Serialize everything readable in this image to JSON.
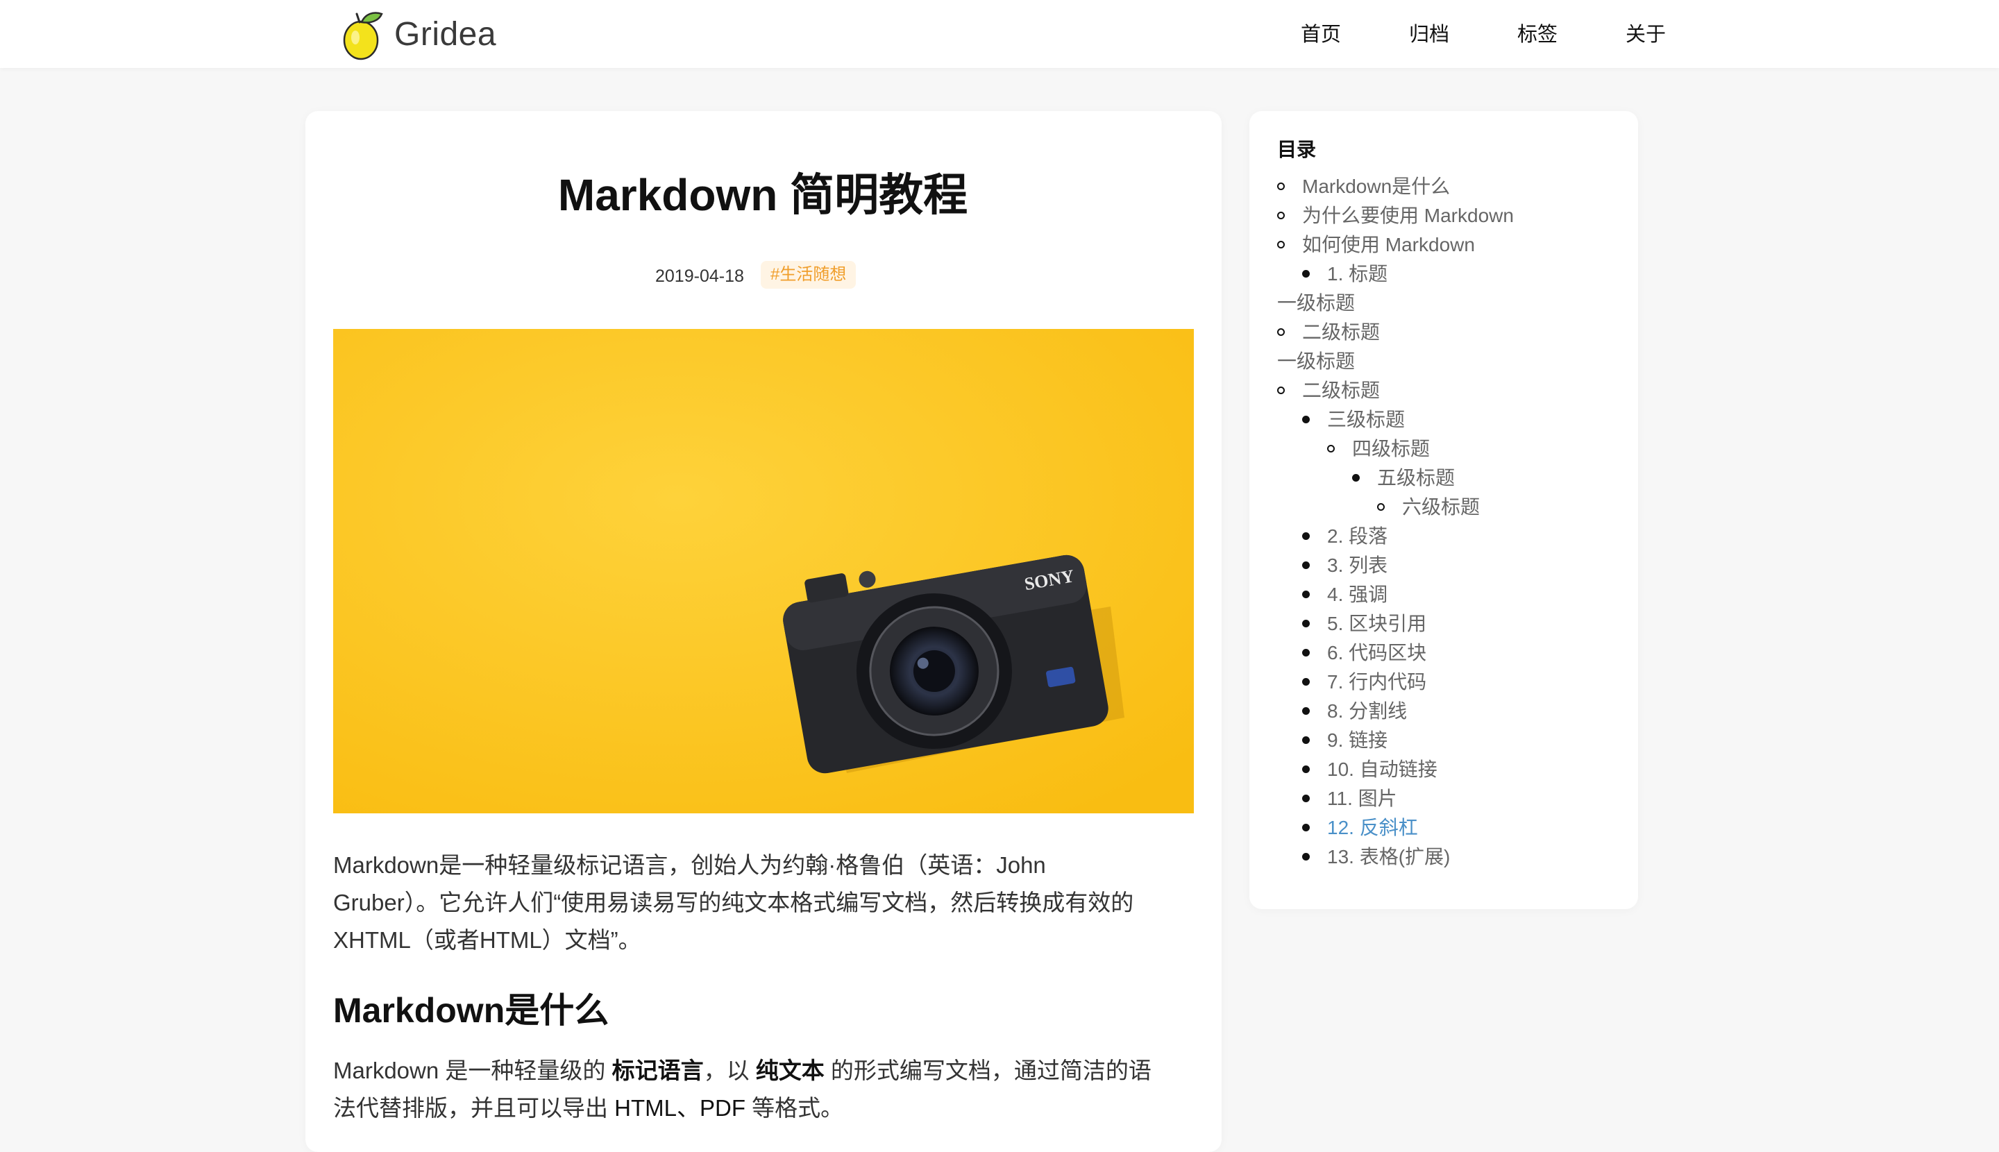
{
  "site": {
    "name": "Gridea"
  },
  "nav": [
    "首页",
    "归档",
    "标签",
    "关于"
  ],
  "post": {
    "title": "Markdown 简明教程",
    "date": "2019-04-18",
    "tag": "#生活随想",
    "intro_lines": [
      "Markdown是一种轻量级标记语言，创始人为约翰·格鲁伯（英语：John",
      "Gruber）。它允许人们“使用易读易写的纯文本格式编写文档，然后转换成有效的",
      "XHTML（或者HTML）文档”。"
    ],
    "section_heading": "Markdown是什么",
    "section_para": {
      "t1": "Markdown 是一种轻量级的 ",
      "b1": "标记语言",
      "t2": "，以 ",
      "b2": "纯文本",
      "t3": " 的形式编写文档，通过简洁的语",
      "line2_a": "法代替排版，并且可以导出 ",
      "line2_b": "HTML、PDF",
      "line2_c": " 等格式。"
    },
    "camera_brand": "SONY"
  },
  "toc": {
    "title": "目录",
    "items": [
      {
        "label": "Markdown是什么",
        "level": 0,
        "bullet": "circle"
      },
      {
        "label": "为什么要使用 Markdown",
        "level": 0,
        "bullet": "circle"
      },
      {
        "label": "如何使用 Markdown",
        "level": 0,
        "bullet": "circle"
      },
      {
        "label": "1. 标题",
        "level": 1,
        "bullet": "disc"
      },
      {
        "label": "一级标题",
        "level": -1,
        "bullet": "none"
      },
      {
        "label": "二级标题",
        "level": 0,
        "bullet": "circle"
      },
      {
        "label": "一级标题",
        "level": -1,
        "bullet": "none"
      },
      {
        "label": "二级标题",
        "level": 0,
        "bullet": "circle"
      },
      {
        "label": "三级标题",
        "level": 1,
        "bullet": "disc"
      },
      {
        "label": "四级标题",
        "level": 2,
        "bullet": "circle"
      },
      {
        "label": "五级标题",
        "level": 3,
        "bullet": "disc"
      },
      {
        "label": "六级标题",
        "level": 4,
        "bullet": "circle"
      },
      {
        "label": "2. 段落",
        "level": 1,
        "bullet": "disc"
      },
      {
        "label": "3. 列表",
        "level": 1,
        "bullet": "disc"
      },
      {
        "label": "4. 强调",
        "level": 1,
        "bullet": "disc"
      },
      {
        "label": "5. 区块引用",
        "level": 1,
        "bullet": "disc"
      },
      {
        "label": "6. 代码区块",
        "level": 1,
        "bullet": "disc"
      },
      {
        "label": "7. 行内代码",
        "level": 1,
        "bullet": "disc"
      },
      {
        "label": "8. 分割线",
        "level": 1,
        "bullet": "disc"
      },
      {
        "label": "9. 链接",
        "level": 1,
        "bullet": "disc"
      },
      {
        "label": "10. 自动链接",
        "level": 1,
        "bullet": "disc"
      },
      {
        "label": "11. 图片",
        "level": 1,
        "bullet": "disc"
      },
      {
        "label": "12. 反斜杠",
        "level": 1,
        "bullet": "disc",
        "active": true
      },
      {
        "label": "13. 表格(扩展)",
        "level": 1,
        "bullet": "disc"
      }
    ]
  },
  "colors": {
    "background": "#f7f7f7",
    "card": "#ffffff",
    "tag_bg": "#fff4e4",
    "tag_text": "#f09e2b",
    "link_active": "#4a90c8",
    "feature_yellow": "#fdc61d"
  }
}
